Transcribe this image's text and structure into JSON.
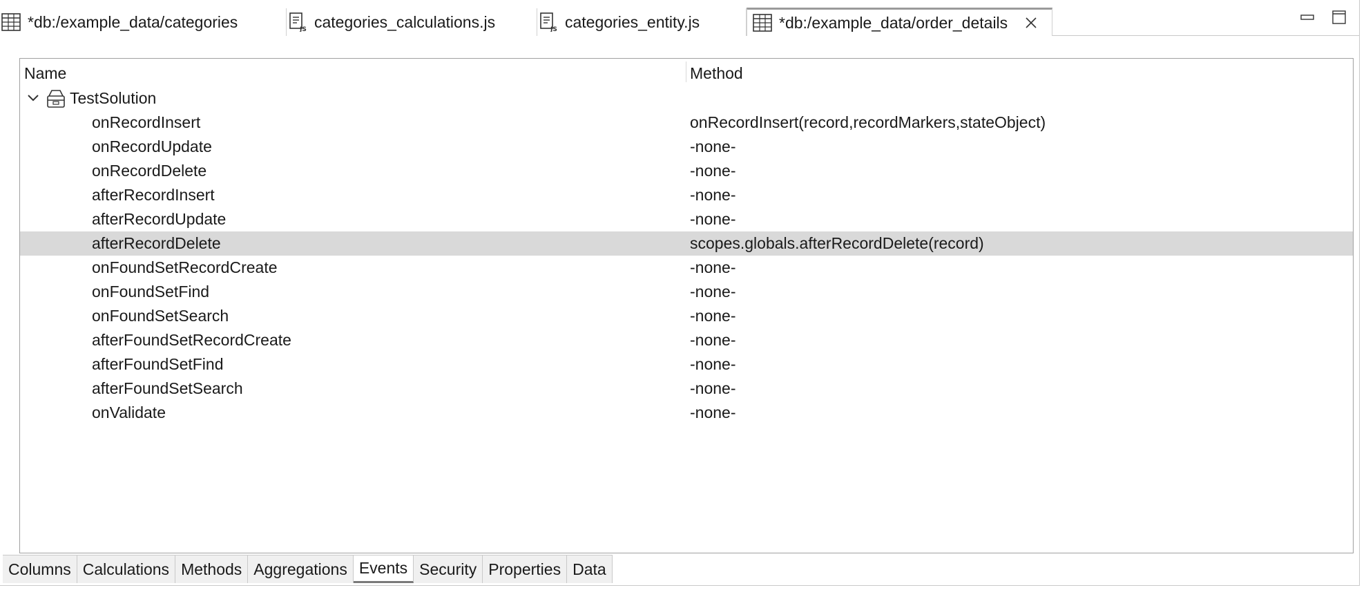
{
  "editor_tabs": [
    {
      "label": "*db:/example_data/categories",
      "icon": "table-icon"
    },
    {
      "label": "categories_calculations.js",
      "icon": "js-file-icon"
    },
    {
      "label": "categories_entity.js",
      "icon": "js-file-icon"
    },
    {
      "label": "*db:/example_data/order_details",
      "icon": "table-icon",
      "active": true
    }
  ],
  "tree": {
    "columns": {
      "name": "Name",
      "method": "Method"
    },
    "root": {
      "label": "TestSolution",
      "icon": "solution-icon",
      "expanded": true
    },
    "rows": [
      {
        "name": "onRecordInsert",
        "method": "onRecordInsert(record,recordMarkers,stateObject)"
      },
      {
        "name": "onRecordUpdate",
        "method": "-none-"
      },
      {
        "name": "onRecordDelete",
        "method": "-none-"
      },
      {
        "name": "afterRecordInsert",
        "method": "-none-"
      },
      {
        "name": "afterRecordUpdate",
        "method": "-none-"
      },
      {
        "name": "afterRecordDelete",
        "method": "scopes.globals.afterRecordDelete(record)",
        "selected": true
      },
      {
        "name": "onFoundSetRecordCreate",
        "method": "-none-"
      },
      {
        "name": "onFoundSetFind",
        "method": "-none-"
      },
      {
        "name": "onFoundSetSearch",
        "method": "-none-"
      },
      {
        "name": "afterFoundSetRecordCreate",
        "method": "-none-"
      },
      {
        "name": "afterFoundSetFind",
        "method": "-none-"
      },
      {
        "name": "afterFoundSetSearch",
        "method": "-none-"
      },
      {
        "name": "onValidate",
        "method": "-none-"
      }
    ]
  },
  "bottom_tabs": [
    {
      "label": "Columns"
    },
    {
      "label": "Calculations"
    },
    {
      "label": "Methods"
    },
    {
      "label": "Aggregations"
    },
    {
      "label": "Events",
      "active": true
    },
    {
      "label": "Security"
    },
    {
      "label": "Properties"
    },
    {
      "label": "Data"
    }
  ],
  "colors": {
    "selected_row": "#d9d9d9",
    "border": "#a0a0a0",
    "tab_background": "#f0f0f0"
  }
}
